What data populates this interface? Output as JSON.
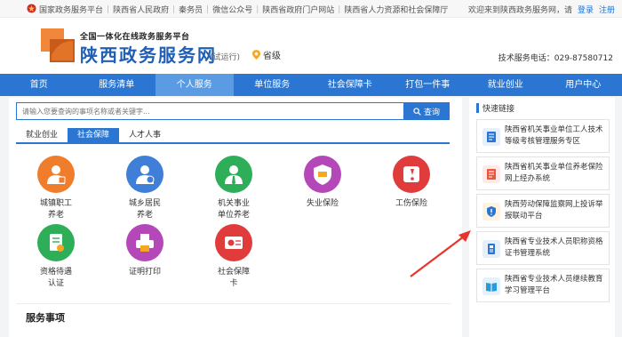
{
  "topbar": {
    "links": [
      "国家政务服务平台",
      "陕西省人民政府",
      "秦务员",
      "微信公众号",
      "陕西省政府门户网站",
      "陕西省人力资源和社会保障厅"
    ],
    "welcome": "欢迎来到陕西政务服务网，请",
    "login": "登录",
    "register": "注册"
  },
  "header": {
    "slogan": "全国一体化在线政务服务平台",
    "title": "陕西政务服务网",
    "trial": "(试运行)",
    "location": "省级",
    "hotline": "技术服务电话：029-87580712"
  },
  "nav": [
    "首页",
    "服务清单",
    "个人服务",
    "单位服务",
    "社会保障卡",
    "打包一件事",
    "就业创业",
    "用户中心"
  ],
  "nav_active": 2,
  "search": {
    "placeholder": "请输入您要查询的事项名称或者关键字...",
    "button": "查询"
  },
  "tabs": [
    "就业创业",
    "社会保障",
    "人才人事"
  ],
  "tab_active": 1,
  "services": [
    {
      "label": "城镇职工\n养老",
      "color": "#f07d2c",
      "icon": "person-icon"
    },
    {
      "label": "城乡居民\n养老",
      "color": "#3f7fd8",
      "icon": "person-icon"
    },
    {
      "label": "机关事业\n单位养老",
      "color": "#2fae59",
      "icon": "person-icon"
    },
    {
      "label": "失业保险",
      "color": "#b548b8",
      "icon": "shield-icon"
    },
    {
      "label": "工伤保险",
      "color": "#e13c3c",
      "icon": "injury-icon"
    },
    {
      "label": "资格待遇\n认证",
      "color": "#2fae59",
      "icon": "document-check-icon"
    },
    {
      "label": "证明打印",
      "color": "#b548b8",
      "icon": "printer-icon"
    },
    {
      "label": "社会保障\n卡",
      "color": "#e13c3c",
      "icon": "card-icon"
    }
  ],
  "section": {
    "title": "服务事项"
  },
  "side": {
    "header": "快速链接",
    "items": [
      {
        "text": "陕西省机关事业单位工人技术等级考核管理服务专区",
        "color": "#2a76d2",
        "icon": "document-icon"
      },
      {
        "text": "陕西省机关事业单位养老保险网上经办系统",
        "color": "#e8563e",
        "icon": "document-icon"
      },
      {
        "text": "陕西劳动保障监察网上投诉举报联动平台",
        "color": "#f5a623",
        "icon": "shield-icon"
      },
      {
        "text": "陕西省专业技术人员职称资格证书管理系统",
        "color": "#2a76d2",
        "icon": "certificate-icon"
      },
      {
        "text": "陕西省专业技术人员继续教育学习管理平台",
        "color": "#2a9bd8",
        "icon": "book-icon"
      }
    ]
  },
  "colors": {
    "primary": "#2a76d2",
    "nav_active": "#5b9be3",
    "arrow": "#e8342b"
  }
}
